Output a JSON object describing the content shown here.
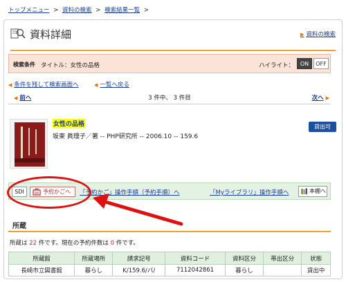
{
  "breadcrumb": {
    "item1": "トップメニュー",
    "item2": "資料の検索",
    "item3": "検索結果一覧",
    "sep": ">"
  },
  "header": {
    "title": "資料詳細",
    "search_link": "資料の検索"
  },
  "conditions": {
    "label": "検索条件",
    "text": "タイトル：女性の品格",
    "highlight_label": "ハイライト：",
    "on_label": "ON",
    "off_label": "OFF"
  },
  "navigation": {
    "keep_conditions": "条件を残して検索画面へ",
    "back_to_list": "一覧へ戻る",
    "prev": "前へ",
    "next": "次へ",
    "page_info": "3 件中、 3 件目"
  },
  "book": {
    "title": "女性の品格",
    "meta": "坂東 眞理子／著 -- PHP研究所 -- 2006.10 -- 159.6",
    "status": "貸出可"
  },
  "actions": {
    "sdi": "SDI",
    "cart": "予約かごへ",
    "cart_help": "「予約かご」操作手順（予約手順）へ",
    "mylibrary_help": "「Myライブラリ」操作手順へ",
    "shelf": "本棚へ"
  },
  "holdings": {
    "section_title": "所蔵",
    "text_prefix": "所蔵は",
    "count": "22",
    "text_mid": "件です。現在の予約件数は",
    "reservations": "0",
    "text_suffix": "件です。",
    "columns": [
      "所蔵館",
      "所蔵場所",
      "請求記号",
      "資料コード",
      "資料区分",
      "帯出区分",
      "状態"
    ],
    "rows": [
      [
        "長崎市立図書館",
        "暮らし",
        "K/159.6/バ/",
        "7112042861",
        "暮らし",
        "",
        "貸出中"
      ]
    ]
  },
  "colors": {
    "accent": "#f0a030",
    "link": "#1a3d9c",
    "annotation": "#e01010"
  }
}
